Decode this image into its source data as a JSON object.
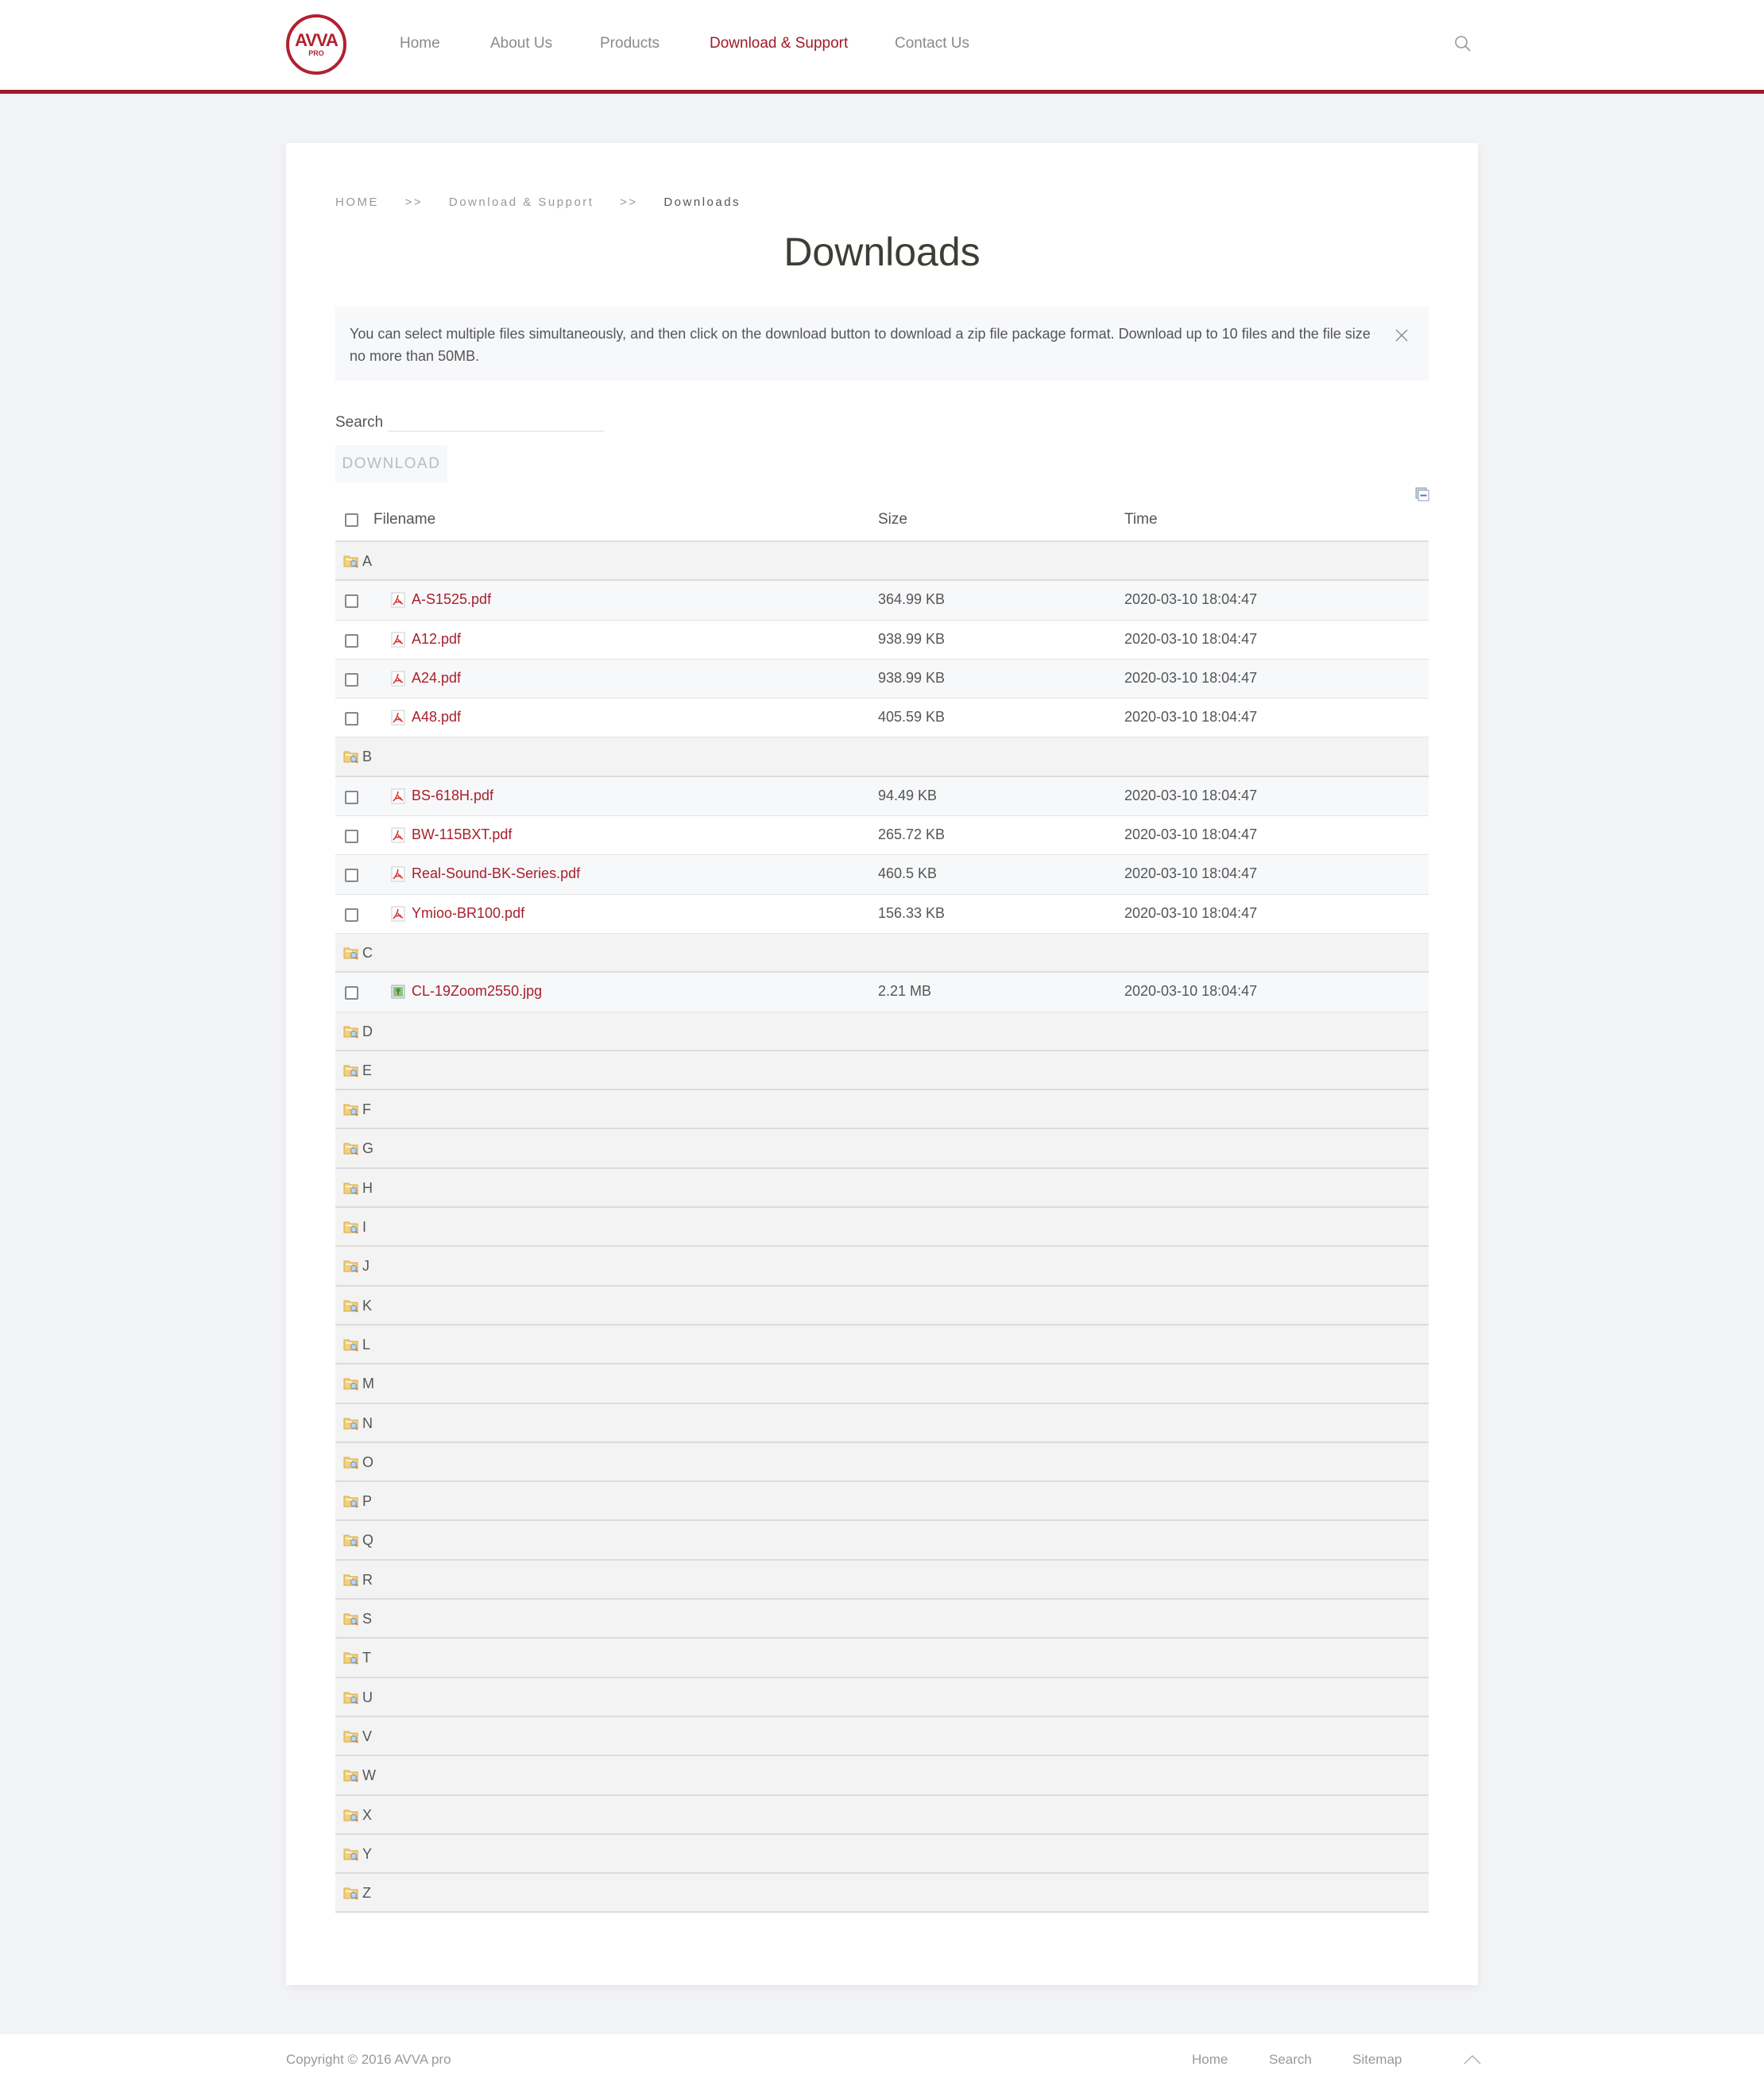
{
  "header": {
    "logo": {
      "main": "AVVA",
      "sub": "PRO"
    },
    "nav": [
      {
        "label": "Home",
        "active": false
      },
      {
        "label": "About Us",
        "active": false
      },
      {
        "label": "Products",
        "active": false
      },
      {
        "label": "Download & Support",
        "active": true
      },
      {
        "label": "Contact Us",
        "active": false
      }
    ],
    "search_icon": "search-icon",
    "accent_color": "#9e1b28"
  },
  "breadcrumb": [
    "HOME",
    ">>",
    "Download & Support",
    ">>",
    "Downloads"
  ],
  "page_title": "Downloads",
  "alert": {
    "text": "You can select multiple files simultaneously, and then click on the download button to download a zip file package format. Download up to 10 files and the file size no more than 50MB.",
    "close_icon": "close-icon"
  },
  "search": {
    "label": "Search",
    "value": "",
    "placeholder": ""
  },
  "download_button": "DOWNLOAD",
  "table": {
    "columns": {
      "filename": "Filename",
      "size": "Size",
      "time": "Time"
    },
    "groups": [
      {
        "letter": "A",
        "files": [
          {
            "name": "A-S1525.pdf",
            "type": "pdf",
            "size": "364.99 KB",
            "time": "2020-03-10 18:04:47"
          },
          {
            "name": "A12.pdf",
            "type": "pdf",
            "size": "938.99 KB",
            "time": "2020-03-10 18:04:47"
          },
          {
            "name": "A24.pdf",
            "type": "pdf",
            "size": "938.99 KB",
            "time": "2020-03-10 18:04:47"
          },
          {
            "name": "A48.pdf",
            "type": "pdf",
            "size": "405.59 KB",
            "time": "2020-03-10 18:04:47"
          }
        ]
      },
      {
        "letter": "B",
        "files": [
          {
            "name": "BS-618H.pdf",
            "type": "pdf",
            "size": "94.49 KB",
            "time": "2020-03-10 18:04:47"
          },
          {
            "name": "BW-115BXT.pdf",
            "type": "pdf",
            "size": "265.72 KB",
            "time": "2020-03-10 18:04:47"
          },
          {
            "name": "Real-Sound-BK-Series.pdf",
            "type": "pdf",
            "size": "460.5 KB",
            "time": "2020-03-10 18:04:47"
          },
          {
            "name": "Ymioo-BR100.pdf",
            "type": "pdf",
            "size": "156.33 KB",
            "time": "2020-03-10 18:04:47"
          }
        ]
      },
      {
        "letter": "C",
        "files": [
          {
            "name": "CL-19Zoom2550.jpg",
            "type": "image",
            "size": "2.21 MB",
            "time": "2020-03-10 18:04:47"
          }
        ]
      },
      {
        "letter": "D",
        "files": []
      },
      {
        "letter": "E",
        "files": []
      },
      {
        "letter": "F",
        "files": []
      },
      {
        "letter": "G",
        "files": []
      },
      {
        "letter": "H",
        "files": []
      },
      {
        "letter": "I",
        "files": []
      },
      {
        "letter": "J",
        "files": []
      },
      {
        "letter": "K",
        "files": []
      },
      {
        "letter": "L",
        "files": []
      },
      {
        "letter": "M",
        "files": []
      },
      {
        "letter": "N",
        "files": []
      },
      {
        "letter": "O",
        "files": []
      },
      {
        "letter": "P",
        "files": []
      },
      {
        "letter": "Q",
        "files": []
      },
      {
        "letter": "R",
        "files": []
      },
      {
        "letter": "S",
        "files": []
      },
      {
        "letter": "T",
        "files": []
      },
      {
        "letter": "U",
        "files": []
      },
      {
        "letter": "V",
        "files": []
      },
      {
        "letter": "W",
        "files": []
      },
      {
        "letter": "X",
        "files": []
      },
      {
        "letter": "Y",
        "files": []
      },
      {
        "letter": "Z",
        "files": []
      }
    ]
  },
  "footer": {
    "copyright": "Copyright © 2016 AVVA pro",
    "links": [
      "Home",
      "Search",
      "Sitemap"
    ],
    "back_to_top_icon": "chevron-up-icon"
  }
}
